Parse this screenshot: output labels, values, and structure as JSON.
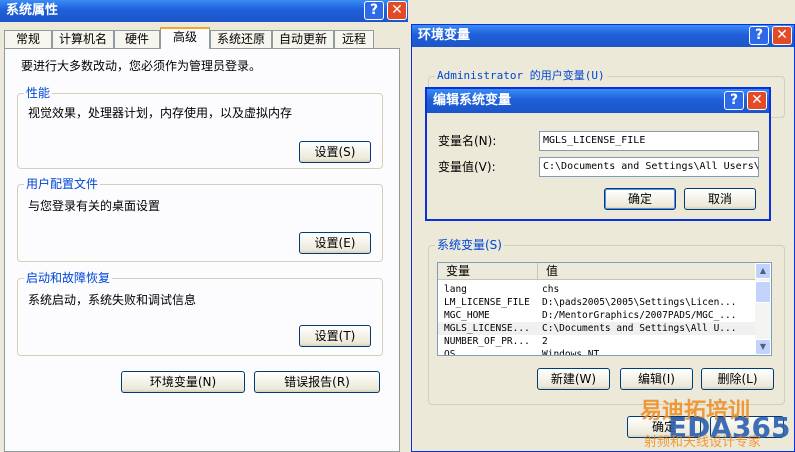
{
  "left_window": {
    "title": "系统属性",
    "tabs": [
      "常规",
      "计算机名",
      "硬件",
      "高级",
      "系统还原",
      "自动更新",
      "远程"
    ],
    "active_tab": "高级",
    "admin_note": "要进行大多数改动，您必须作为管理员登录。",
    "groups": {
      "performance": {
        "label": "性能",
        "desc": "视觉效果，处理器计划，内存使用，以及虚拟内存",
        "button": "设置(S)"
      },
      "profiles": {
        "label": "用户配置文件",
        "desc": "与您登录有关的桌面设置",
        "button": "设置(E)"
      },
      "startup": {
        "label": "启动和故障恢复",
        "desc": "系统启动，系统失败和调试信息",
        "button": "设置(T)"
      }
    },
    "env_button": "环境变量(N)",
    "error_button": "错误报告(R)"
  },
  "env_window": {
    "title": "环境变量",
    "user_vars_label": "Administrator 的用户变量(U)",
    "sys_vars_label": "系统变量(S)",
    "columns": [
      "变量",
      "值"
    ],
    "rows": [
      {
        "name": "lang",
        "value": "chs"
      },
      {
        "name": "LM_LICENSE_FILE",
        "value": "D:\\pads2005\\2005\\Settings\\Licen..."
      },
      {
        "name": "MGC_HOME",
        "value": "D:/MentorGraphics/2007PADS/MGC_..."
      },
      {
        "name": "MGLS_LICENSE...",
        "value": "C:\\Documents and Settings\\All U..."
      },
      {
        "name": "NUMBER_OF_PR...",
        "value": "2"
      },
      {
        "name": "OS",
        "value": "Windows_NT"
      }
    ],
    "new_button": "新建(W)",
    "edit_button": "编辑(I)",
    "delete_button": "删除(L)",
    "ok_button": "确定"
  },
  "edit_dialog": {
    "title": "编辑系统变量",
    "name_label": "变量名(N):",
    "name_value": "MGLS_LICENSE_FILE",
    "value_label": "变量值(V):",
    "value_value": "C:\\Documents and Settings\\All Users\\",
    "ok": "确定",
    "cancel": "取消"
  },
  "watermark": {
    "brand_cn": "易迪拓培训",
    "brand_en": "EDA365",
    "tagline": "射频和天线设计专家"
  },
  "titlebar_icons": [
    "help-icon",
    "close-icon"
  ]
}
